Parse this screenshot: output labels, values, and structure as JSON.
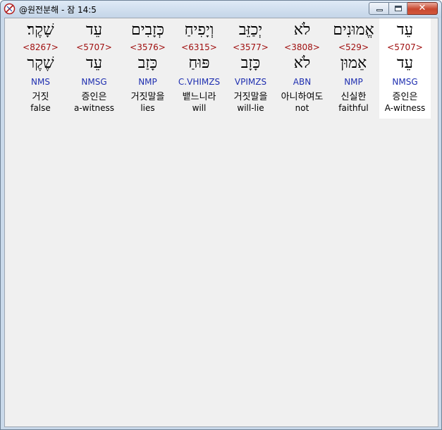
{
  "window": {
    "title": "@원전분해 - 잠 14:5"
  },
  "words": [
    {
      "inflected": "עֵד",
      "strong": "<5707>",
      "lemma": "עֵד",
      "morph": "NMSG",
      "korean": "증인은",
      "english": "A-witness",
      "selected": true
    },
    {
      "inflected": "אֱמוּנִים",
      "strong": "<529>",
      "lemma": "אֵמוּן",
      "morph": "NMP",
      "korean": "신실한",
      "english": "faithful",
      "selected": false
    },
    {
      "inflected": "לֹא",
      "strong": "<3808>",
      "lemma": "לֹא",
      "morph": "ABN",
      "korean": "아니하여도",
      "english": "not",
      "selected": false
    },
    {
      "inflected": "יְכַזֵּב",
      "strong": "<3577>",
      "lemma": "כָּזָב",
      "morph": "VPIMZS",
      "korean": "거짓말을",
      "english": "will-lie",
      "selected": false
    },
    {
      "inflected": "וְיָפִיחַ",
      "strong": "<6315>",
      "lemma": "פּוּחַ",
      "morph": "C.VHIMZS",
      "korean": "뱉느니라",
      "english": "will",
      "selected": false
    },
    {
      "inflected": "כְּזָבִים",
      "strong": "<3576>",
      "lemma": "כָּזַב",
      "morph": "NMP",
      "korean": "거짓말을",
      "english": "lies",
      "selected": false
    },
    {
      "inflected": "עֵד",
      "strong": "<5707>",
      "lemma": "עֵד",
      "morph": "NMSG",
      "korean": "증인은",
      "english": "a-witness",
      "selected": false
    },
    {
      "inflected": "שָׁקֶר׃",
      "strong": "<8267>",
      "lemma": "שֶׁקֶר",
      "morph": "NMS",
      "korean": "거짓",
      "english": "false",
      "selected": false
    }
  ]
}
